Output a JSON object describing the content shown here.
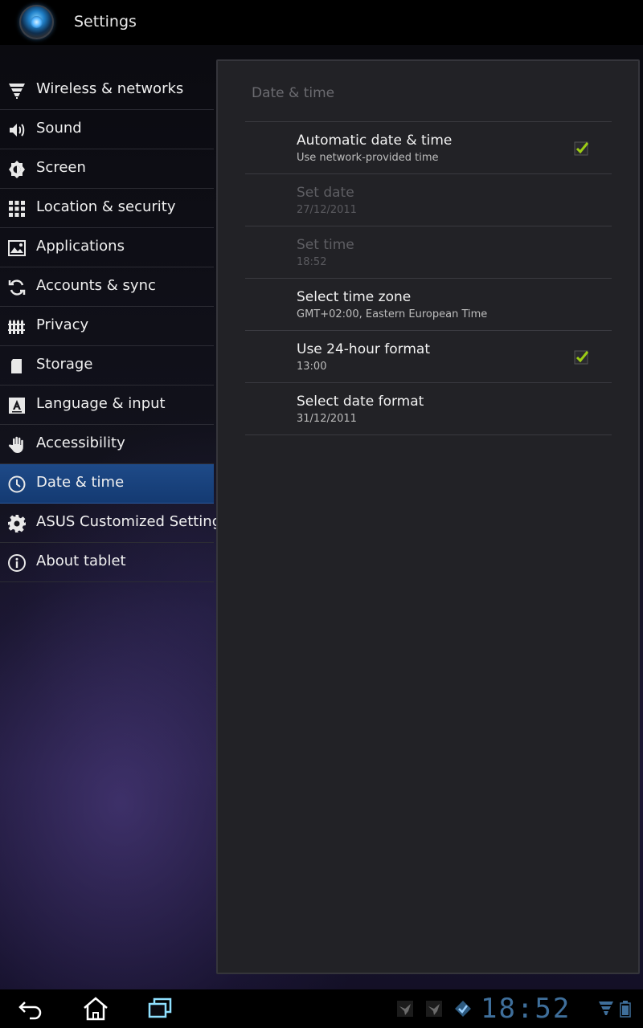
{
  "action_bar": {
    "title": "Settings",
    "icon": "settings-app-icon"
  },
  "sidebar": {
    "items": [
      {
        "label": "Wireless & networks",
        "icon": "wifi-icon"
      },
      {
        "label": "Sound",
        "icon": "speaker-icon"
      },
      {
        "label": "Screen",
        "icon": "brightness-icon"
      },
      {
        "label": "Location & security",
        "icon": "grid-dots-icon"
      },
      {
        "label": "Applications",
        "icon": "applications-icon"
      },
      {
        "label": "Accounts & sync",
        "icon": "sync-icon"
      },
      {
        "label": "Privacy",
        "icon": "fence-icon"
      },
      {
        "label": "Storage",
        "icon": "sd-card-icon"
      },
      {
        "label": "Language & input",
        "icon": "language-a-icon"
      },
      {
        "label": "Accessibility",
        "icon": "hand-icon"
      },
      {
        "label": "Date & time",
        "icon": "clock-icon",
        "selected": true
      },
      {
        "label": "ASUS Customized Setting",
        "icon": "gear-icon"
      },
      {
        "label": "About tablet",
        "icon": "info-icon"
      }
    ]
  },
  "content": {
    "section_header": "Date & time",
    "prefs": [
      {
        "title": "Automatic date & time",
        "summary": "Use network-provided time",
        "checked": true,
        "enabled": true
      },
      {
        "title": "Set date",
        "summary": "27/12/2011",
        "enabled": false
      },
      {
        "title": "Set time",
        "summary": "18:52",
        "enabled": false
      },
      {
        "title": "Select time zone",
        "summary": "GMT+02:00, Eastern European Time",
        "enabled": true
      },
      {
        "title": "Use 24-hour format",
        "summary": "13:00",
        "checked": true,
        "enabled": true
      },
      {
        "title": "Select date format",
        "summary": "31/12/2011",
        "enabled": true
      }
    ]
  },
  "system_bar": {
    "clock": "18:52",
    "buttons": [
      "back-icon",
      "home-icon",
      "recent-apps-icon"
    ],
    "tray": [
      "notification-bird-icon",
      "notification-bird-icon",
      "sync-check-icon",
      "wifi-signal-icon",
      "battery-icon"
    ]
  },
  "colors": {
    "selected_item": "#1e4a88",
    "checkmark": "#9ccc14",
    "clock": "#3f6f9b"
  }
}
